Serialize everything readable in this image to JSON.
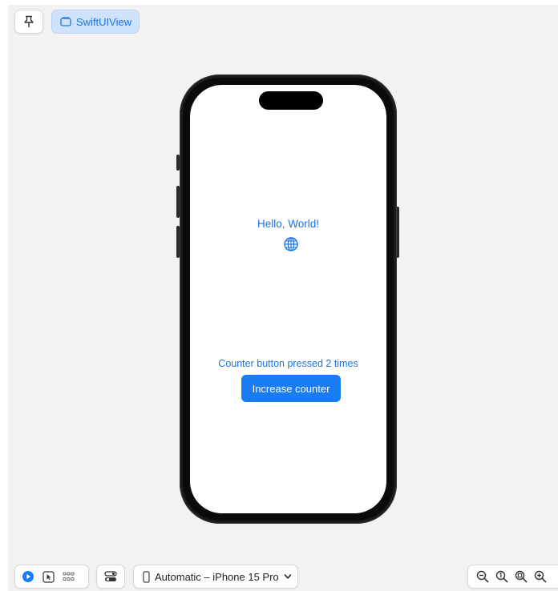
{
  "toolbar": {
    "pin_icon": "pin-icon",
    "preview_tab_label": "SwiftUIView",
    "preview_tab_icon": "preview-window-icon"
  },
  "device_screen": {
    "greeting": "Hello, World!",
    "globe_icon": "globe-icon",
    "counter_text": "Counter button pressed 2 times",
    "increase_button_label": "Increase counter",
    "accent_color": "#1a73e8"
  },
  "bottom_bar": {
    "mode_icons": [
      "live-preview-icon",
      "selectable-mode-icon",
      "variants-grid-icon"
    ],
    "settings_icon": "device-settings-icon",
    "device_selector_label": "Automatic – iPhone 15 Pro",
    "zoom_icons": [
      "zoom-out-icon",
      "zoom-actual-size-icon",
      "zoom-to-fit-icon",
      "zoom-in-icon"
    ]
  }
}
